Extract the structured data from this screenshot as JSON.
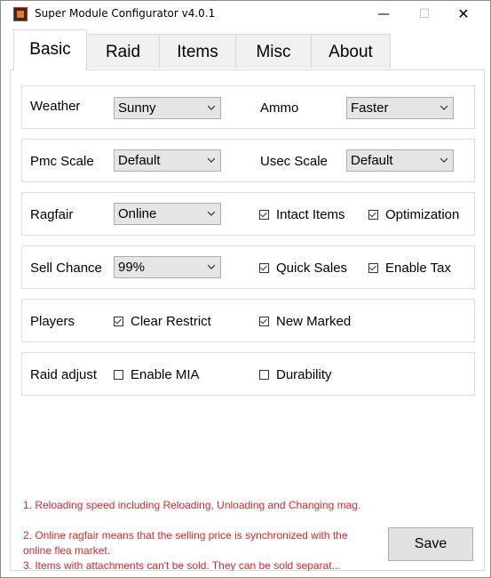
{
  "window": {
    "title": "Super Module Configurator v4.0.1",
    "min": "—",
    "max": "☐",
    "close": "✕"
  },
  "tabs": [
    "Basic",
    "Raid",
    "Items",
    "Misc",
    "About"
  ],
  "rows": {
    "r1": {
      "weather_label": "Weather",
      "weather_value": "Sunny",
      "ammo_label": "Ammo",
      "ammo_value": "Faster"
    },
    "r2": {
      "pmc_label": "Pmc Scale",
      "pmc_value": "Default",
      "usec_label": "Usec Scale",
      "usec_value": "Default"
    },
    "r3": {
      "ragfair_label": "Ragfair",
      "ragfair_value": "Online",
      "intact_label": "Intact Items",
      "intact_checked": true,
      "optim_label": "Optimization",
      "optim_checked": true
    },
    "r4": {
      "sell_label": "Sell Chance",
      "sell_value": "99%",
      "quick_label": "Quick Sales",
      "quick_checked": true,
      "tax_label": "Enable Tax",
      "tax_checked": true
    },
    "r5": {
      "players_label": "Players",
      "clear_label": "Clear Restrict",
      "clear_checked": true,
      "marked_label": "New Marked",
      "marked_checked": true
    },
    "r6": {
      "raid_label": "Raid adjust",
      "mia_label": "Enable MIA",
      "mia_checked": false,
      "dur_label": "Durability",
      "dur_checked": false
    }
  },
  "notes": [
    "1. Reloading speed including Reloading, Unloading and Changing mag.",
    "2. Online ragfair means that the selling price is synchronized with the online flea market.",
    "3. Items with attachments can't be sold. They can be sold separat..."
  ],
  "save_label": "Save"
}
